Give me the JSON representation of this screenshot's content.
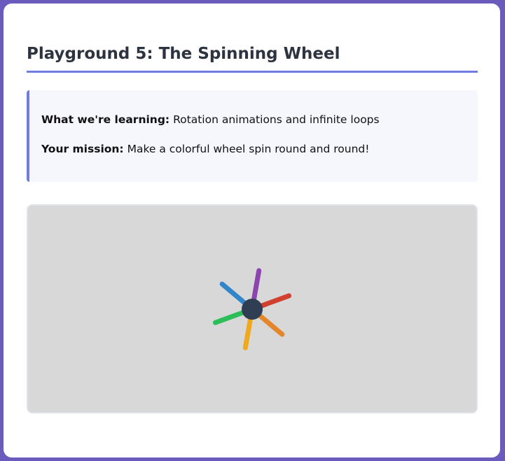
{
  "playground": {
    "title": "Playground 5: The Spinning Wheel",
    "learning_label": "What we're learning:",
    "learning_text": "Rotation animations and infinite loops",
    "mission_label": "Your mission:",
    "mission_text": "Make a colorful wheel spin round and round!"
  },
  "wheel": {
    "hub_color": "#2f3e52",
    "spokes": [
      {
        "name": "purple",
        "color": "#8e44ad"
      },
      {
        "name": "red",
        "color": "#d23f2f"
      },
      {
        "name": "orange",
        "color": "#e6862a"
      },
      {
        "name": "yellow",
        "color": "#f0a81c"
      },
      {
        "name": "green",
        "color": "#2dbe5a"
      },
      {
        "name": "blue",
        "color": "#3185c8"
      }
    ]
  }
}
